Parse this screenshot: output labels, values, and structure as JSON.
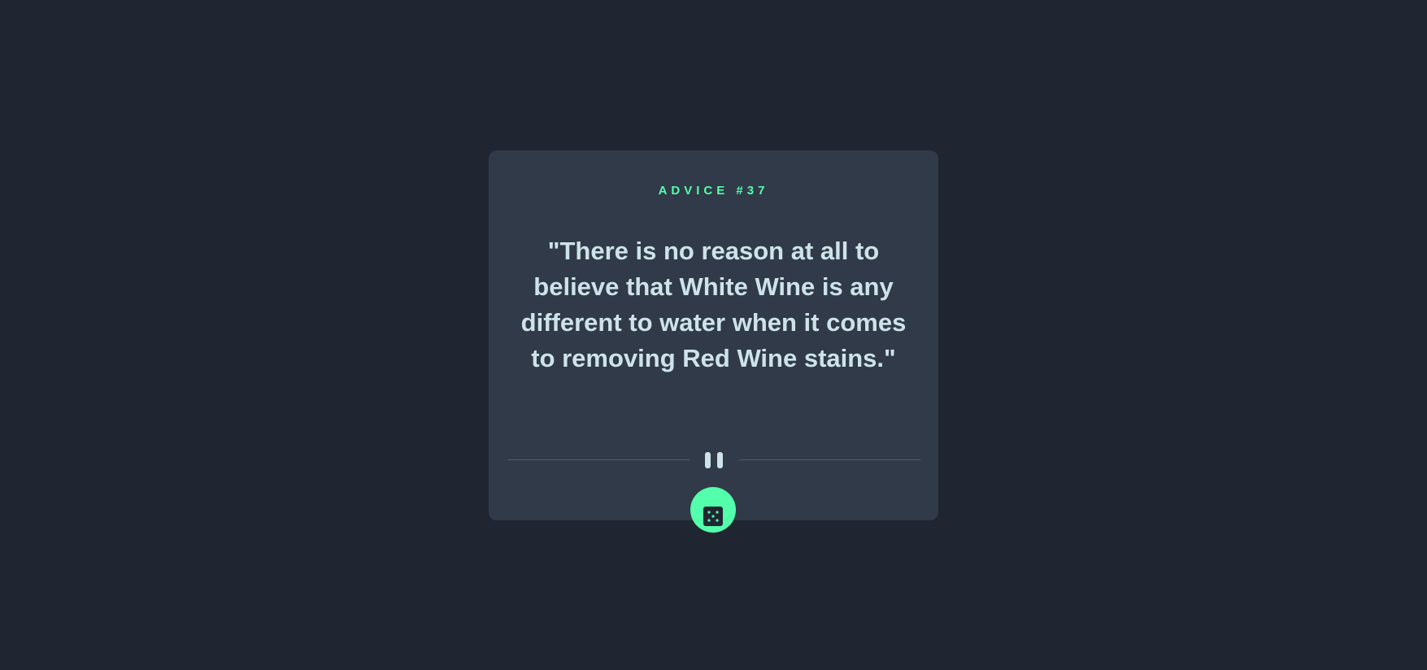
{
  "advice": {
    "label": "Advice #37",
    "quote": "\"There is no reason at all to believe that White Wine is any different to water when it comes to removing Red Wine stains.\""
  },
  "divider": {
    "icon": "pause-icon"
  },
  "dice_button": {
    "icon": "dice-icon"
  },
  "colors": {
    "background": "#1f2632",
    "card": "#313a48",
    "accent": "#53ffaa",
    "text": "#cee3e9",
    "divider": "#4f5d74"
  }
}
